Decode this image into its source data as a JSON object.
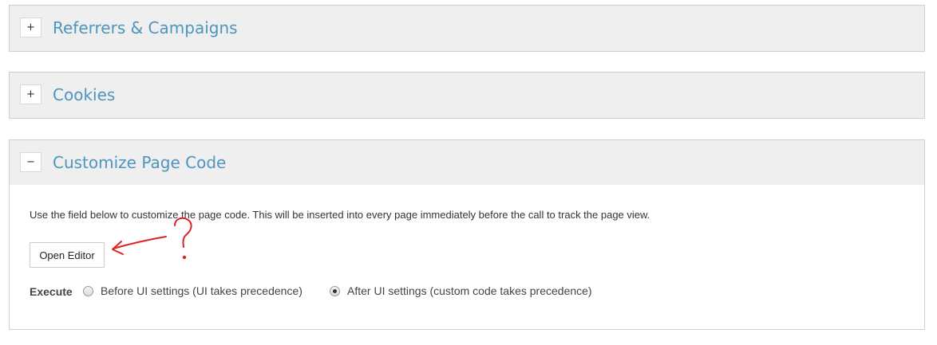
{
  "panels": {
    "referrers": {
      "toggle": "+",
      "title": "Referrers & Campaigns"
    },
    "cookies": {
      "toggle": "+",
      "title": "Cookies"
    },
    "custom_code": {
      "toggle": "−",
      "title": "Customize Page Code",
      "description": "Use the field below to customize the page code. This will be inserted into every page immediately before the call to track the page view.",
      "open_editor_label": "Open Editor",
      "execute": {
        "label": "Execute",
        "options": [
          {
            "label": "Before UI settings (UI takes precedence)",
            "selected": false
          },
          {
            "label": "After UI settings (custom code takes precedence)",
            "selected": true
          }
        ]
      }
    }
  },
  "colors": {
    "title": "#4e95bf",
    "header_bg": "#efefef",
    "annotation": "#e02020"
  }
}
